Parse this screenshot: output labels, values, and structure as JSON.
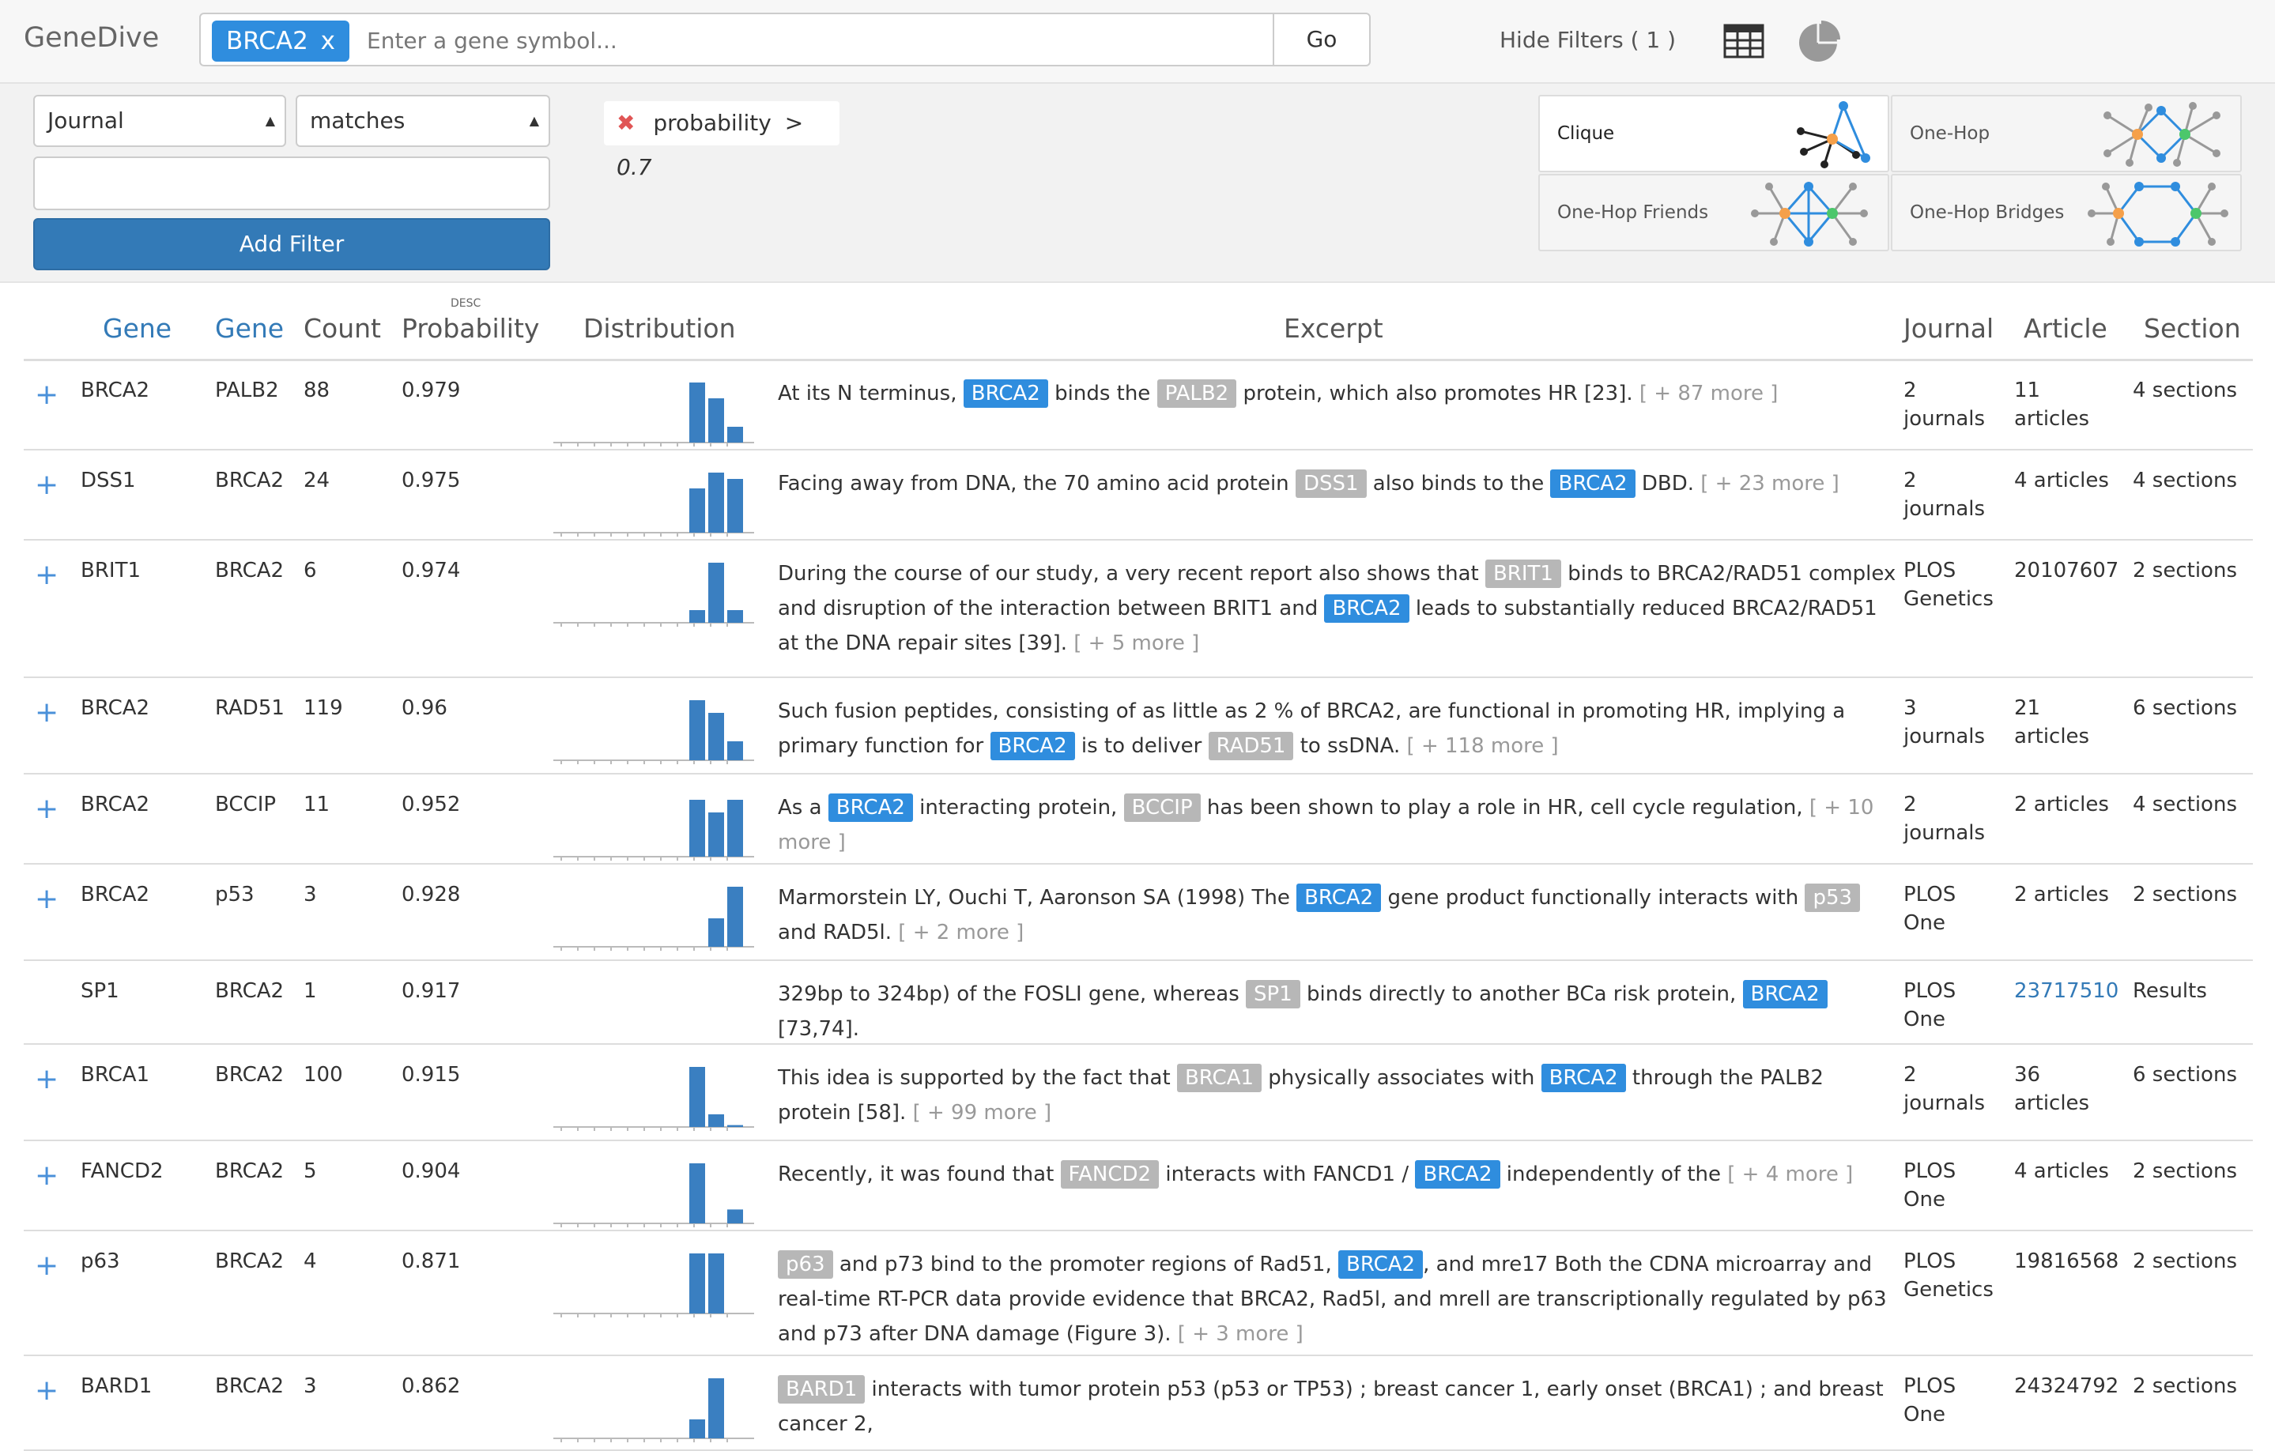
{
  "app": {
    "title": "GeneDive"
  },
  "search": {
    "chip_label": "BRCA2",
    "chip_remove": "x",
    "placeholder": "Enter a gene symbol...",
    "go_label": "Go"
  },
  "toolbar": {
    "hide_filters": "Hide Filters ( 1 )",
    "grid_icon": "table-grid-icon",
    "pie_icon": "pie-chart-icon"
  },
  "filters": {
    "attribute_select": "Journal",
    "operator_select": "matches",
    "value_input": "",
    "add_button": "Add Filter",
    "active": {
      "remove": "✖",
      "field": "probability",
      "op": ">",
      "value": "0.7"
    }
  },
  "views": [
    {
      "label": "Clique",
      "active": true
    },
    {
      "label": "One-Hop",
      "active": false
    },
    {
      "label": "One-Hop Friends",
      "active": false
    },
    {
      "label": "One-Hop Bridges",
      "active": false
    }
  ],
  "colors": {
    "accent": "#2f8dde",
    "tag_grey": "#b7b7b7",
    "button": "#337ab7",
    "node_orange": "#f5a04a",
    "node_green": "#4cc76b"
  },
  "table": {
    "headers": {
      "gene1": "Gene",
      "gene2": "Gene",
      "count": "Count",
      "probability": "Probability",
      "sort": "DESC",
      "distribution": "Distribution",
      "excerpt": "Excerpt",
      "journal": "Journal",
      "article": "Article",
      "section": "Section"
    },
    "rows": [
      {
        "expand": "+",
        "gene1": "BRCA2",
        "gene2": "PALB2",
        "count": "88",
        "prob": "0.979",
        "ex": [
          "At its N terminus,",
          "BRCA2",
          "binds the",
          "PALB2",
          "protein, which also promotes HR [23].",
          "[ + 87 more ]"
        ],
        "journal": [
          "2",
          "journals"
        ],
        "article": [
          "11",
          "articles"
        ],
        "section": "4 sections",
        "dist": [
          0,
          0,
          0,
          0,
          0,
          0,
          0,
          0,
          0,
          0.95,
          0.7,
          0.25
        ]
      },
      {
        "expand": "+",
        "gene1": "DSS1",
        "gene2": "BRCA2",
        "count": "24",
        "prob": "0.975",
        "ex": [
          "Facing away from DNA, the 70 amino acid protein",
          "DSS1",
          "also binds to the",
          "BRCA2",
          "DBD.",
          "[ + 23 more ]"
        ],
        "journal": [
          "2",
          "journals"
        ],
        "article": [
          "4 articles",
          ""
        ],
        "section": "4 sections",
        "dist": [
          0,
          0,
          0,
          0,
          0,
          0,
          0,
          0,
          0,
          0.7,
          0.95,
          0.85
        ]
      },
      {
        "expand": "+",
        "gene1": "BRIT1",
        "gene2": "BRCA2",
        "count": "6",
        "prob": "0.974",
        "ex": [
          "During the course of our study, a very recent report also shows that",
          "BRIT1",
          "binds to BRCA2/RAD51 complex and disruption of the interaction between BRIT1 and",
          "BRCA2",
          "leads to substantially reduced BRCA2/RAD51 at the DNA repair sites [39].",
          "[ + 5 more ]"
        ],
        "journal": [
          "PLOS",
          "Genetics"
        ],
        "article": [
          "20107607",
          ""
        ],
        "section": "2 sections",
        "dist": [
          0,
          0,
          0,
          0,
          0,
          0,
          0,
          0,
          0,
          0.2,
          0.95,
          0.2
        ]
      },
      {
        "expand": "+",
        "gene1": "BRCA2",
        "gene2": "RAD51",
        "count": "119",
        "prob": "0.96",
        "ex": [
          "Such fusion peptides, consisting of as little as 2 % of BRCA2, are functional in promoting HR, implying a primary function for",
          "BRCA2",
          "is to deliver",
          "RAD51",
          "to ssDNA.",
          "[ + 118 more ]"
        ],
        "journal": [
          "3",
          "journals"
        ],
        "article": [
          "21",
          "articles"
        ],
        "section": "6 sections",
        "dist": [
          0,
          0,
          0,
          0,
          0,
          0,
          0,
          0,
          0,
          0.95,
          0.75,
          0.3
        ]
      },
      {
        "expand": "+",
        "gene1": "BRCA2",
        "gene2": "BCCIP",
        "count": "11",
        "prob": "0.952",
        "ex": [
          "As a",
          "BRCA2",
          "interacting protein,",
          "BCCIP",
          "has been shown to play a role in HR, cell cycle regulation,",
          "[ + 10 more ]"
        ],
        "journal": [
          "2",
          "journals"
        ],
        "article": [
          "2 articles",
          ""
        ],
        "section": "4 sections",
        "dist": [
          0,
          0,
          0,
          0,
          0,
          0,
          0,
          0,
          0,
          0.9,
          0.7,
          0.9
        ]
      },
      {
        "expand": "+",
        "gene1": "BRCA2",
        "gene2": "p53",
        "count": "3",
        "prob": "0.928",
        "ex": [
          "Marmorstein LY, Ouchi T, Aaronson SA (1998) The",
          "BRCA2",
          "gene product functionally interacts with",
          "p53",
          "and RAD5l.",
          "[ + 2 more ]"
        ],
        "journal": [
          "PLOS",
          "One"
        ],
        "article": [
          "2 articles",
          ""
        ],
        "section": "2 sections",
        "dist": [
          0,
          0,
          0,
          0,
          0,
          0,
          0,
          0,
          0,
          0,
          0.45,
          0.95
        ]
      },
      {
        "expand": "",
        "gene1": "SP1",
        "gene2": "BRCA2",
        "count": "1",
        "prob": "0.917",
        "ex": [
          "329bp to 324bp) of the FOSLI gene, whereas",
          "SP1",
          "binds directly to another BCa risk protein,",
          "BRCA2",
          "[73,74].",
          ""
        ],
        "journal": [
          "PLOS",
          "One"
        ],
        "article": [
          "23717510",
          ""
        ],
        "section": "Results",
        "dist": []
      },
      {
        "expand": "+",
        "gene1": "BRCA1",
        "gene2": "BRCA2",
        "count": "100",
        "prob": "0.915",
        "ex": [
          "This idea is supported by the fact that",
          "BRCA1",
          "physically associates with",
          "BRCA2",
          "through the PALB2 protein [58].",
          "[ + 99 more ]"
        ],
        "journal": [
          "2",
          "journals"
        ],
        "article": [
          "36",
          "articles"
        ],
        "section": "6 sections",
        "dist": [
          0,
          0,
          0,
          0,
          0,
          0,
          0,
          0,
          0,
          0.95,
          0.2,
          0.03
        ]
      },
      {
        "expand": "+",
        "gene1": "FANCD2",
        "gene2": "BRCA2",
        "count": "5",
        "prob": "0.904",
        "ex": [
          "Recently, it was found that",
          "FANCD2",
          "interacts with FANCD1 /",
          "BRCA2",
          "independently of the",
          "[ + 4 more ]"
        ],
        "journal": [
          "PLOS",
          "One"
        ],
        "article": [
          "4 articles",
          ""
        ],
        "section": "2 sections",
        "dist": [
          0,
          0,
          0,
          0,
          0,
          0,
          0,
          0,
          0,
          0.95,
          0,
          0.22
        ]
      },
      {
        "expand": "+",
        "gene1": "p63",
        "gene2": "BRCA2",
        "count": "4",
        "prob": "0.871",
        "ex": [
          "",
          "p63",
          "and p73 bind to the promoter regions of Rad51,",
          "BRCA2",
          ", and mre17 Both the CDNA microarray and real-time RT-PCR data provide evidence that BRCA2, Rad5l, and mrell are transcriptionally regulated by p63 and p73 after DNA damage (Figure 3).",
          "[ + 3 more ]"
        ],
        "journal": [
          "PLOS",
          "Genetics"
        ],
        "article": [
          "19816568",
          ""
        ],
        "section": "2 sections",
        "dist": [
          0,
          0,
          0,
          0,
          0,
          0,
          0,
          0,
          0,
          0.95,
          0.95,
          0
        ]
      },
      {
        "expand": "+",
        "gene1": "BARD1",
        "gene2": "BRCA2",
        "count": "3",
        "prob": "0.862",
        "ex": [
          "",
          "BARD1",
          "interacts with tumor protein p53 (p53 or TP53) ; breast cancer 1, early onset (BRCA1) ; and breast cancer 2,",
          "",
          "",
          ""
        ],
        "journal": [
          "PLOS",
          "One"
        ],
        "article": [
          "24324792",
          ""
        ],
        "section": "2 sections",
        "dist": [
          0,
          0,
          0,
          0,
          0,
          0,
          0,
          0,
          0,
          0.3,
          0.95,
          0
        ]
      }
    ]
  }
}
